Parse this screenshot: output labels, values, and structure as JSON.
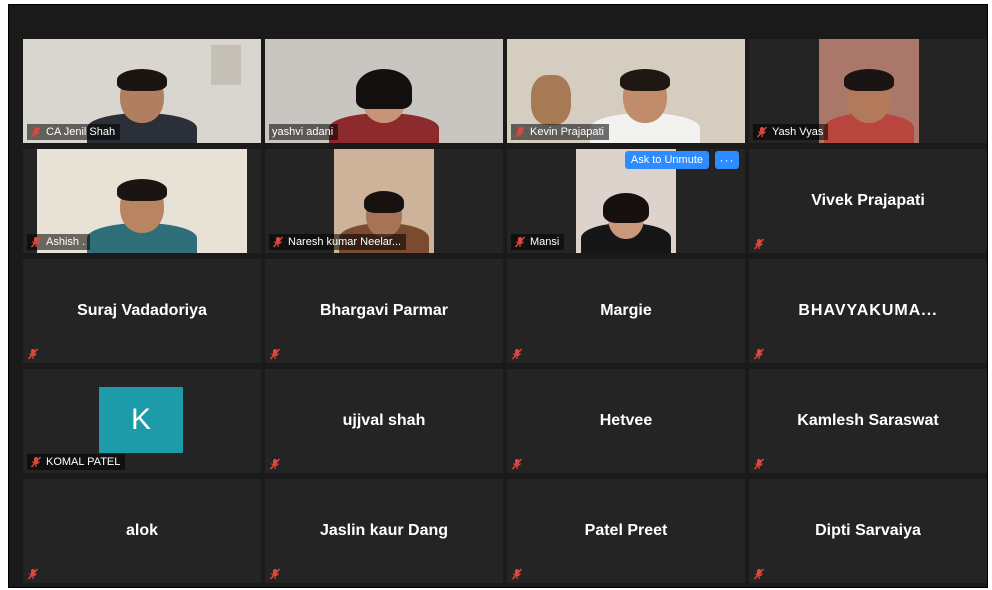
{
  "meeting": {
    "ask_to_unmute_label": "Ask to Unmute",
    "more_label": "···",
    "colors": {
      "active_border": "#c8e86a",
      "mute_icon": "#e0483e",
      "accent": "#2d8cff",
      "avatar_bg": "#1e9ba8"
    }
  },
  "participants": [
    {
      "name": "CA Jenil Shah",
      "video": true,
      "muted": true,
      "active": true
    },
    {
      "name": "yashvi adani",
      "video": true,
      "muted": false
    },
    {
      "name": "Kevin Prajapati",
      "video": true,
      "muted": true
    },
    {
      "name": "Yash Vyas",
      "video": true,
      "muted": true
    },
    {
      "name": "Ashish .",
      "video": true,
      "muted": true
    },
    {
      "name": "Naresh kumar Neelar...",
      "video": true,
      "muted": true
    },
    {
      "name": "Mansi",
      "video": true,
      "muted": true
    },
    {
      "name": "Vivek Prajapati",
      "video": false,
      "muted": true
    },
    {
      "name": "Suraj Vadadoriya",
      "video": false,
      "muted": true
    },
    {
      "name": "Bhargavi Parmar",
      "video": false,
      "muted": true
    },
    {
      "name": "Margie",
      "video": false,
      "muted": true
    },
    {
      "name": "BHAVYAKUMA...",
      "video": false,
      "muted": true
    },
    {
      "name": "KOMAL PATEL",
      "avatar_letter": "K",
      "video": false,
      "muted": true
    },
    {
      "name": "ujjval shah",
      "video": false,
      "muted": true
    },
    {
      "name": "Hetvee",
      "video": false,
      "muted": true
    },
    {
      "name": "Kamlesh Saraswat",
      "video": false,
      "muted": true
    },
    {
      "name": "alok",
      "video": false,
      "muted": true
    },
    {
      "name": "Jaslin kaur Dang",
      "video": false,
      "muted": true
    },
    {
      "name": "Patel Preet",
      "video": false,
      "muted": true
    },
    {
      "name": "Dipti Sarvaiya",
      "video": false,
      "muted": true
    }
  ]
}
